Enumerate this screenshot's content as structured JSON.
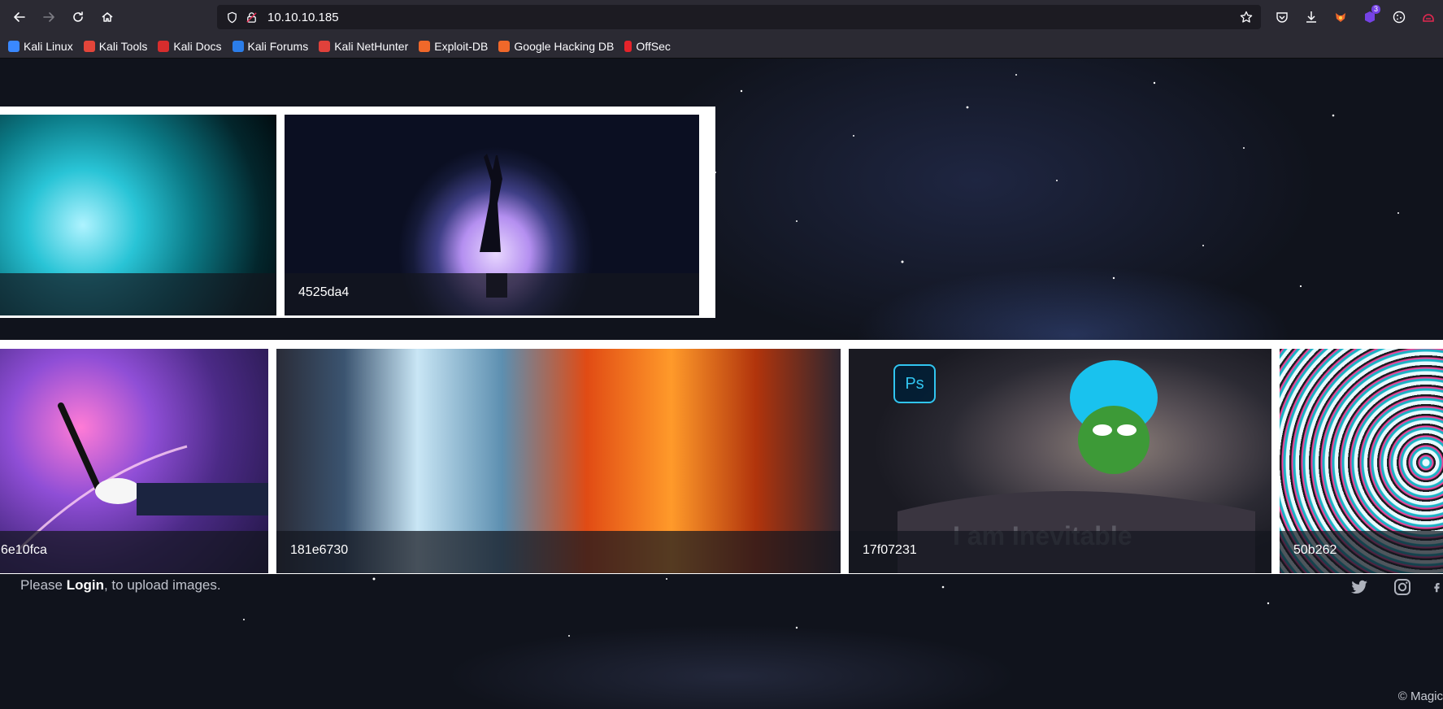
{
  "browser": {
    "url": "10.10.10.185",
    "extensions_badge": "3"
  },
  "bookmarks": [
    {
      "label": "Kali Linux",
      "color": "#3a88fe"
    },
    {
      "label": "Kali Tools",
      "color": "#e3453a"
    },
    {
      "label": "Kali Docs",
      "color": "#d72d2d"
    },
    {
      "label": "Kali Forums",
      "color": "#2b7de9"
    },
    {
      "label": "Kali NetHunter",
      "color": "#e0413b"
    },
    {
      "label": "Exploit-DB",
      "color": "#f0682a"
    },
    {
      "label": "Google Hacking DB",
      "color": "#f0682a"
    },
    {
      "label": "OffSec",
      "color": "#e5232a"
    }
  ],
  "gallery": {
    "row1": [
      {
        "caption": ""
      },
      {
        "caption": "4525da4"
      }
    ],
    "row2": [
      {
        "caption": "6e10fca"
      },
      {
        "caption": "181e6730"
      },
      {
        "caption": "17f07231",
        "overlay_text": "I am Inevitable",
        "badge_text": "Ps"
      },
      {
        "caption": "50b262"
      }
    ]
  },
  "footer": {
    "login_prefix": "Please ",
    "login_link": "Login",
    "login_suffix": ", to upload images.",
    "copyright": "© Magic"
  },
  "colors": {
    "chrome_bg": "#2b2a33",
    "url_bg": "#1c1b22",
    "accent": "#31c5f0"
  }
}
